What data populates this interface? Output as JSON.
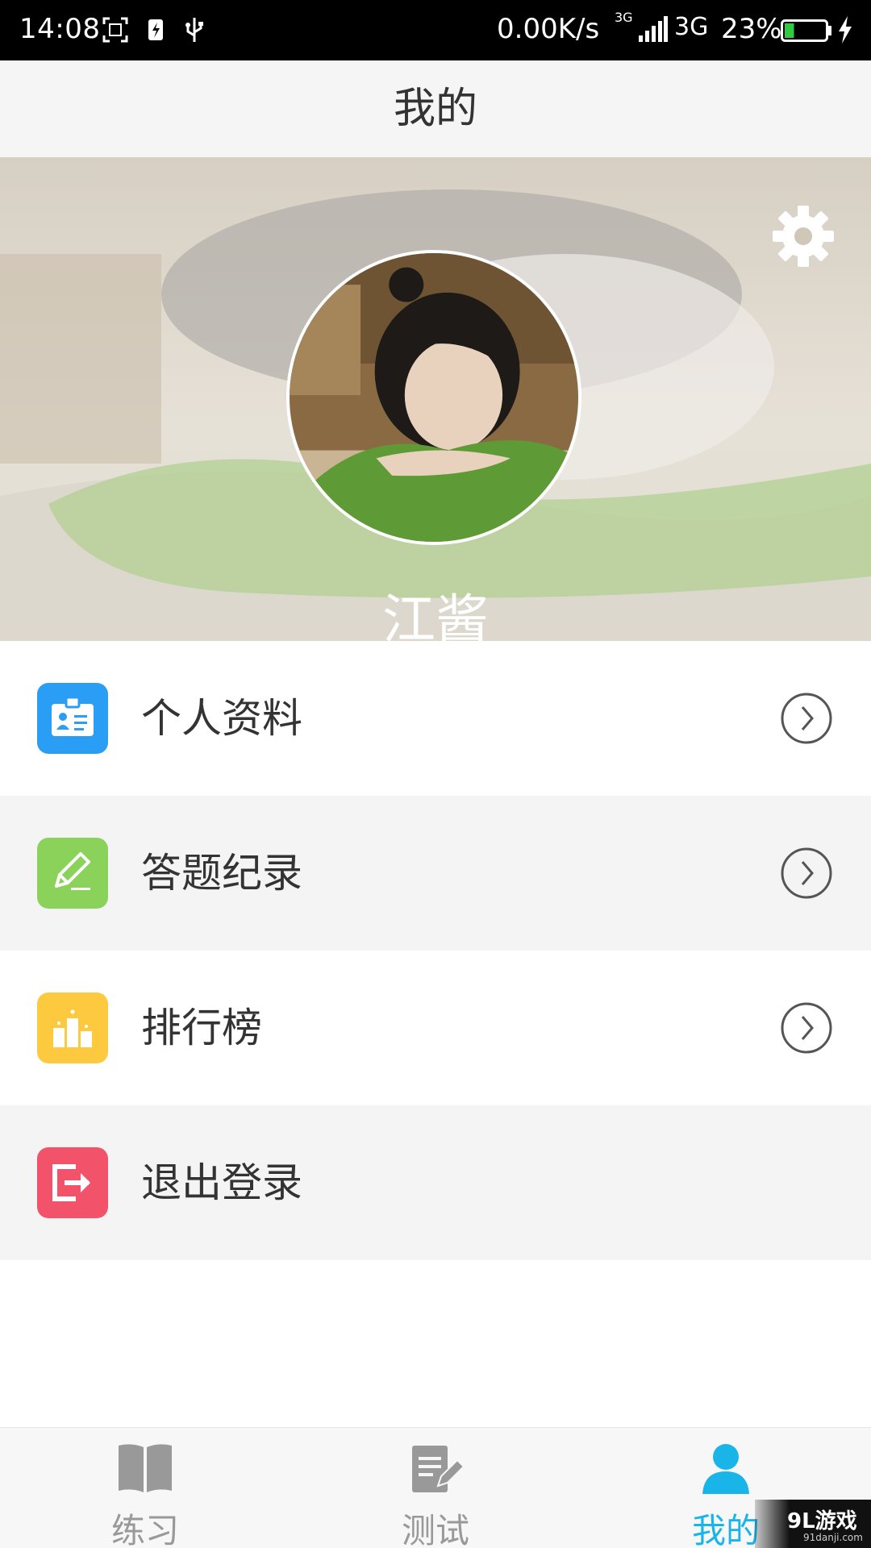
{
  "status_bar": {
    "time": "14:08",
    "network_speed": "0.00K/s",
    "signal_small": "3G",
    "network_type": "3G",
    "battery_percent": "23%",
    "battery_level": 0.23
  },
  "header": {
    "title": "我的"
  },
  "profile": {
    "username": "江酱",
    "settings_icon": "gear-icon"
  },
  "menu": {
    "items": [
      {
        "label": "个人资料",
        "icon": "id-card-icon",
        "color": "#2a9df4"
      },
      {
        "label": "答题纪录",
        "icon": "pencil-icon",
        "color": "#8bd25a"
      },
      {
        "label": "排行榜",
        "icon": "podium-icon",
        "color": "#fdca3f"
      },
      {
        "label": "退出登录",
        "icon": "logout-icon",
        "color": "#f2526a"
      }
    ]
  },
  "bottom_nav": {
    "tabs": [
      {
        "label": "练习",
        "icon": "book-icon"
      },
      {
        "label": "测试",
        "icon": "test-doc-icon"
      },
      {
        "label": "我的",
        "icon": "user-icon"
      }
    ],
    "active_index": 2,
    "active_color": "#1ab5e8"
  },
  "watermark": {
    "main": "9L游戏",
    "sub": "91danji.com"
  }
}
